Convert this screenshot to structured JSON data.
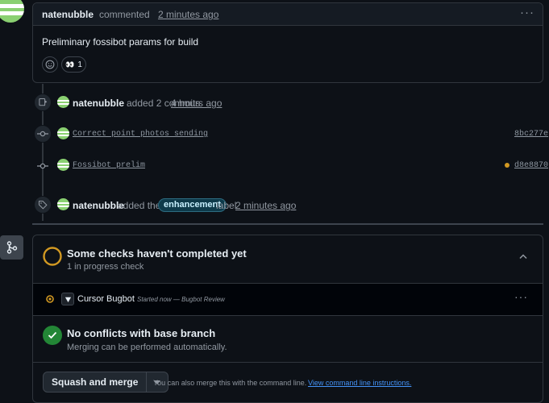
{
  "comment": {
    "author": "natenubble",
    "action": "commented",
    "time": "2 minutes ago",
    "body": "Preliminary fossibot params for build",
    "reaction_emoji": "👀",
    "reaction_count": "1"
  },
  "commits_event": {
    "author": "natenubble",
    "action": "added 2 commits",
    "time": "4 hours ago",
    "commits": [
      {
        "message": "Correct point photos sending",
        "sha": "8bc277e",
        "status": "none"
      },
      {
        "message": "Fossibot prelim",
        "sha": "d8e8870",
        "status": "pending"
      }
    ]
  },
  "label_event": {
    "author": "natenubble",
    "action_prefix": "added the",
    "label": "enhancement",
    "action_suffix": "label",
    "time": "2 minutes ago"
  },
  "checks": {
    "title": "Some checks haven't completed yet",
    "subtitle": "1 in progress check",
    "items": [
      {
        "name": "Cursor Bugbot",
        "detail": "Started now — Bugbot Review"
      }
    ]
  },
  "conflicts": {
    "title": "No conflicts with base branch",
    "subtitle": "Merging can be performed automatically."
  },
  "merge": {
    "button_label": "Squash and merge",
    "hint": "You can also merge this with the command line.",
    "hint_link": "View command line instructions."
  },
  "colors": {
    "background": "#0d1117",
    "border": "#30363d",
    "pending": "#d29922",
    "success": "#238636",
    "link": "#4493f8",
    "avatar_green": "#8ad071"
  }
}
